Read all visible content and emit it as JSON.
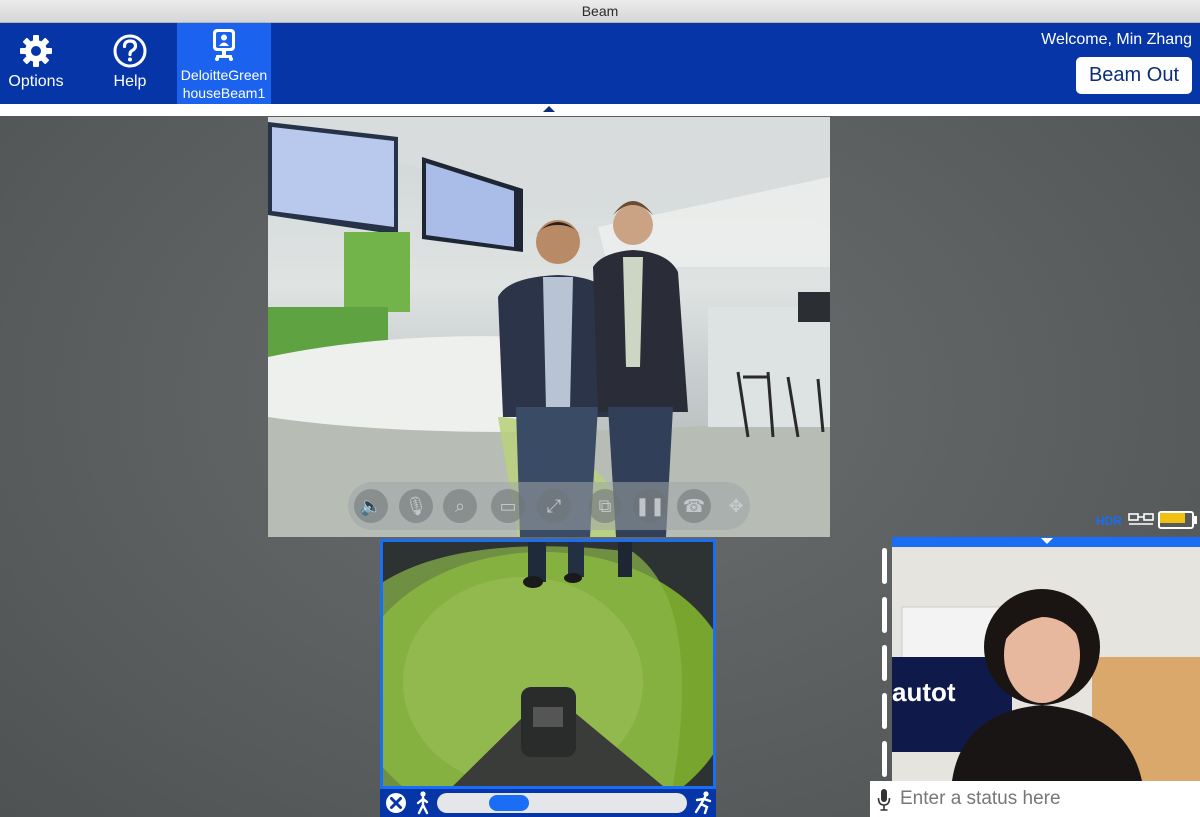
{
  "window": {
    "title": "Beam"
  },
  "toolbar": {
    "options_label": "Options",
    "help_label": "Help",
    "robot_name_line1": "DeloitteGreen",
    "robot_name_line2": "houseBeam1",
    "welcome_text": "Welcome, Min Zhang",
    "beam_out_label": "Beam Out"
  },
  "main_video": {
    "controls": [
      "speaker-icon",
      "microphone-icon",
      "zoom-icon",
      "presentation-icon",
      "fit-screen-icon",
      "picture-in-picture-icon",
      "pause-icon",
      "hang-up-icon",
      "move-icon"
    ]
  },
  "drive": {
    "slider_fraction": 0.24
  },
  "robot_status": {
    "hdr_label": "HDR",
    "battery_fraction": 0.88,
    "battery_color": "#f2c012"
  },
  "self_view": {
    "status_placeholder": "Enter a status here",
    "screen_text": "autot"
  },
  "colors": {
    "toolbar": "#0535a6",
    "accent": "#1a6df5",
    "selected_tab": "#1b63ee"
  }
}
